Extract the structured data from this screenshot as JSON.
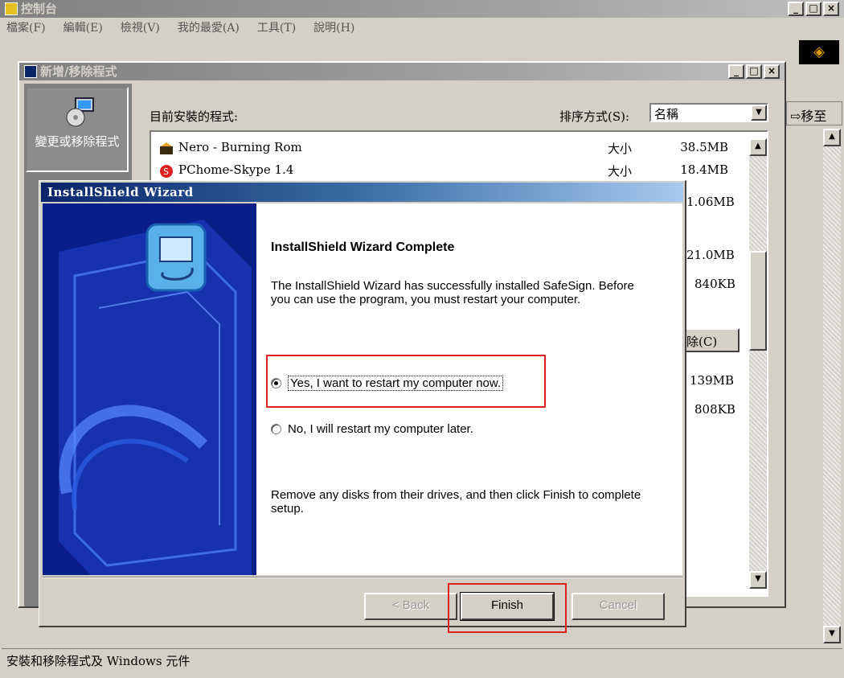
{
  "control_panel": {
    "title": "控制台",
    "menu": [
      "檔案(F)",
      "編輯(E)",
      "檢視(V)",
      "我的最愛(A)",
      "工具(T)",
      "說明(H)"
    ],
    "address_fragment": "移至",
    "status": "安裝和移除程式及 Windows 元件"
  },
  "add_remove": {
    "title": "新增/移除程式",
    "left_button_label": "變更或移除程式",
    "installed_label": "目前安裝的程式:",
    "sort_label": "排序方式(S):",
    "sort_value": "名稱",
    "programs": [
      {
        "name": "Nero - Burning Rom",
        "size_label": "大小",
        "size": "38.5MB"
      },
      {
        "name": "PChome-Skype 1.4",
        "size_label": "大小",
        "size": "18.4MB"
      }
    ],
    "partial_sizes": [
      "1.06MB",
      "21.0MB",
      "840KB",
      "139MB",
      "808KB"
    ],
    "remove_button": "除(C)"
  },
  "wizard": {
    "title": "InstallShield Wizard",
    "heading": "InstallShield Wizard Complete",
    "description": "The InstallShield Wizard has successfully installed SafeSign. Before you can use the program, you must restart your computer.",
    "option_yes": "Yes, I want to restart my computer now.",
    "option_no": "No, I will restart my computer later.",
    "remove_disks": "Remove any disks from their drives, and then click Finish to complete setup.",
    "back_button": "< Back",
    "finish_button": "Finish",
    "cancel_button": "Cancel"
  },
  "window_buttons": {
    "minimize": "_",
    "maximize": "□",
    "close": "×"
  },
  "colors": {
    "highlight": "#e02020",
    "titlebar_active": "#0a246a"
  }
}
